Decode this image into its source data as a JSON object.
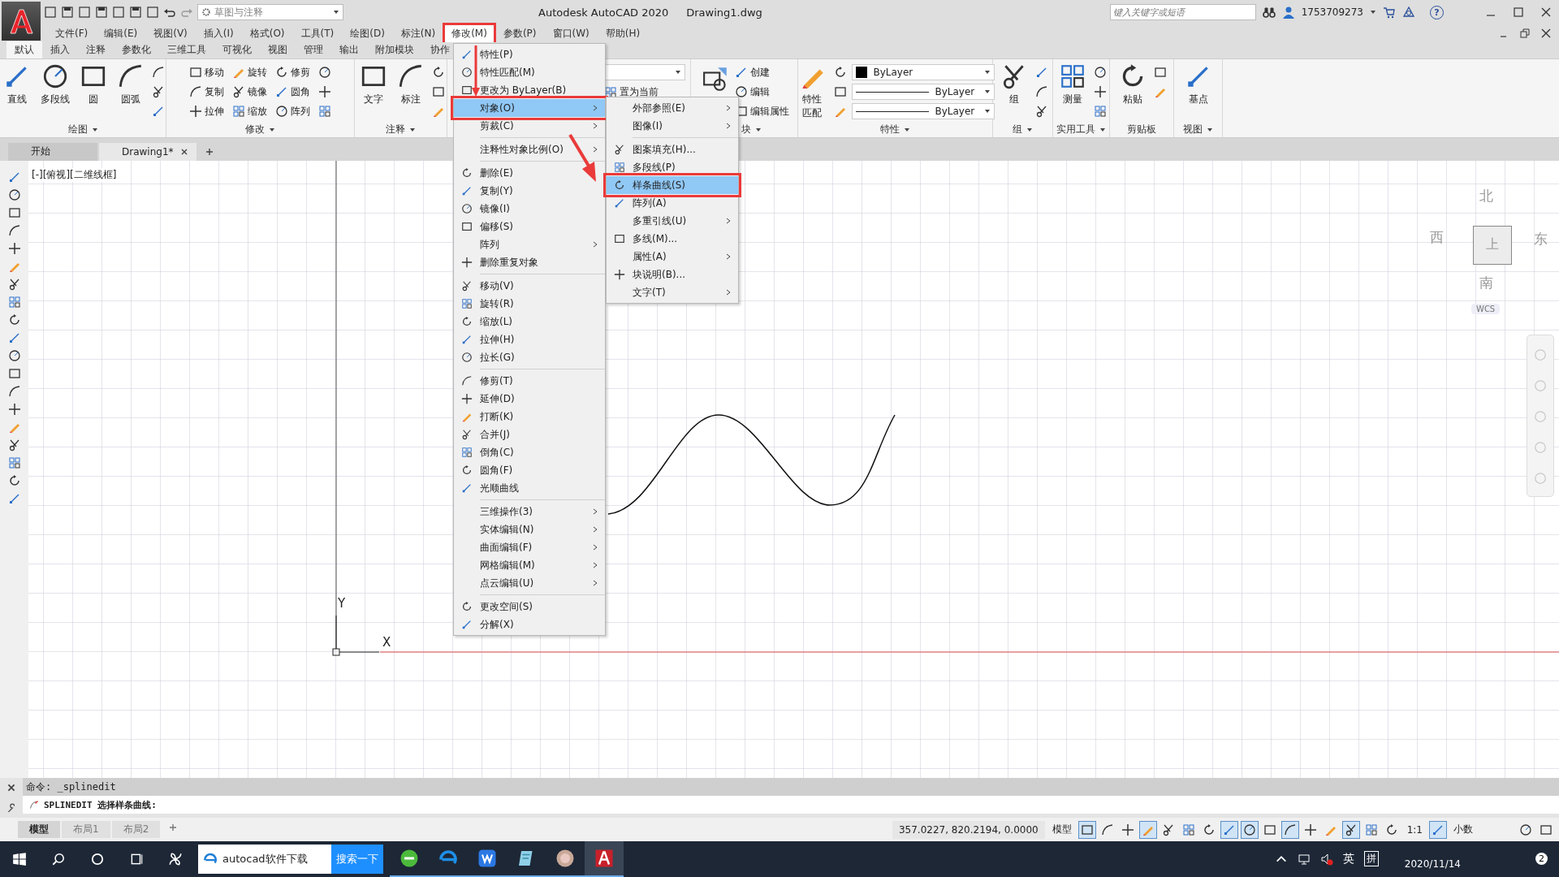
{
  "title_bar": {
    "workspace": "草图与注释",
    "title": "Autodesk AutoCAD 2020",
    "filename": "Drawing1.dwg",
    "search_placeholder": "键入关键字或短语",
    "user": "1753709273",
    "help": "?"
  },
  "menu_bar": [
    {
      "label": "文件(F)",
      "selected": false
    },
    {
      "label": "编辑(E)",
      "selected": false
    },
    {
      "label": "视图(V)",
      "selected": false
    },
    {
      "label": "插入(I)",
      "selected": false
    },
    {
      "label": "格式(O)",
      "selected": false
    },
    {
      "label": "工具(T)",
      "selected": false
    },
    {
      "label": "绘图(D)",
      "selected": false
    },
    {
      "label": "标注(N)",
      "selected": false
    },
    {
      "label": "修改(M)",
      "selected": true
    },
    {
      "label": "参数(P)",
      "selected": false
    },
    {
      "label": "窗口(W)",
      "selected": false
    },
    {
      "label": "帮助(H)",
      "selected": false
    }
  ],
  "ribbon_tabs": [
    {
      "label": "默认",
      "selected": true
    },
    {
      "label": "插入",
      "selected": false
    },
    {
      "label": "注释",
      "selected": false
    },
    {
      "label": "参数化",
      "selected": false
    },
    {
      "label": "三维工具",
      "selected": false
    },
    {
      "label": "可视化",
      "selected": false
    },
    {
      "label": "视图",
      "selected": false
    },
    {
      "label": "管理",
      "selected": false
    },
    {
      "label": "输出",
      "selected": false
    },
    {
      "label": "附加模块",
      "selected": false
    },
    {
      "label": "协作",
      "selected": false
    }
  ],
  "ribbon_panels": [
    {
      "title": "绘图",
      "menu": true,
      "tools": [
        {
          "kind": "large",
          "label": "直线"
        },
        {
          "kind": "large",
          "label": "多段线"
        },
        {
          "kind": "large",
          "label": "圆"
        },
        {
          "kind": "large",
          "label": "圆弧"
        },
        {
          "kind": "icon"
        },
        {
          "kind": "icon"
        },
        {
          "kind": "icon"
        }
      ]
    },
    {
      "title": "修改",
      "menu": true,
      "tools": [
        {
          "kind": "small",
          "label": "移动"
        },
        {
          "kind": "small",
          "label": "复制"
        },
        {
          "kind": "small",
          "label": "拉伸"
        },
        {
          "kind": "small",
          "label": "旋转"
        },
        {
          "kind": "small",
          "label": "镜像"
        },
        {
          "kind": "small",
          "label": "缩放"
        },
        {
          "kind": "small",
          "label": "修剪"
        },
        {
          "kind": "small",
          "label": "圆角"
        },
        {
          "kind": "small",
          "label": "阵列"
        },
        {
          "kind": "icon"
        },
        {
          "kind": "icon"
        },
        {
          "kind": "icon"
        }
      ]
    },
    {
      "title": "注释",
      "menu": true,
      "tools": [
        {
          "kind": "large",
          "label": "文字"
        },
        {
          "kind": "large",
          "label": "标注"
        },
        {
          "kind": "icon"
        },
        {
          "kind": "icon"
        },
        {
          "kind": "icon"
        }
      ]
    },
    {
      "tools": [
        {
          "kind": "dropdown"
        },
        {
          "kind": "small",
          "label": "置为当前"
        }
      ]
    },
    {
      "title": "块",
      "menu": true,
      "tools": [
        {
          "kind": "bigicon"
        },
        {
          "kind": "small",
          "label": "创建"
        },
        {
          "kind": "small",
          "label": "编辑"
        },
        {
          "kind": "small",
          "label": "编辑属性"
        }
      ]
    },
    {
      "title": "特性",
      "menu": true,
      "tools": [
        {
          "kind": "large",
          "label": "特性匹配"
        },
        {
          "kind": "icon"
        },
        {
          "kind": "icon"
        },
        {
          "kind": "icon"
        },
        {
          "kind": "colordropdown",
          "value": "ByLayer"
        },
        {
          "kind": "linedropdown",
          "value": "ByLayer"
        },
        {
          "kind": "linedropdown",
          "value": "ByLayer"
        }
      ]
    },
    {
      "title": "组",
      "menu": true,
      "tools": [
        {
          "kind": "large",
          "label": "组"
        },
        {
          "kind": "icon"
        },
        {
          "kind": "icon"
        },
        {
          "kind": "icon"
        }
      ]
    },
    {
      "title": "实用工具",
      "menu": true,
      "tools": [
        {
          "kind": "large",
          "label": "测量"
        },
        {
          "kind": "icon"
        },
        {
          "kind": "icon"
        },
        {
          "kind": "icon"
        }
      ]
    },
    {
      "title": "剪贴板",
      "menu": false,
      "tools": [
        {
          "kind": "large",
          "label": "粘贴"
        },
        {
          "kind": "icon"
        },
        {
          "kind": "icon"
        }
      ]
    },
    {
      "title": "视图",
      "menu": true,
      "tools": [
        {
          "kind": "large",
          "label": "基点"
        }
      ]
    }
  ],
  "document_tabs": [
    {
      "label": "开始",
      "selected": false
    },
    {
      "label": "Drawing1*",
      "selected": true
    }
  ],
  "viewport_label": "[-][俯视][二维线框]",
  "viewcube": {
    "north": "北",
    "south": "南",
    "east": "东",
    "west": "西",
    "face": "上",
    "ucs": "WCS"
  },
  "axes": {
    "y": "Y",
    "x": "X"
  },
  "modify_menu": [
    {
      "kind": "item",
      "label": "特性(P)",
      "icon": true,
      "submenu": false,
      "selected": false
    },
    {
      "kind": "item",
      "label": "特性匹配(M)",
      "icon": true,
      "submenu": false,
      "selected": false
    },
    {
      "kind": "item",
      "label": "更改为 ByLayer(B)",
      "icon": true,
      "submenu": false,
      "selected": false
    },
    {
      "kind": "item",
      "label": "对象(O)",
      "icon": false,
      "submenu": true,
      "selected": true
    },
    {
      "kind": "item",
      "label": "剪裁(C)",
      "icon": false,
      "submenu": true,
      "selected": false
    },
    {
      "kind": "separator"
    },
    {
      "kind": "item",
      "label": "注释性对象比例(O)",
      "icon": false,
      "submenu": true,
      "selected": false
    },
    {
      "kind": "separator"
    },
    {
      "kind": "item",
      "label": "删除(E)",
      "icon": true,
      "submenu": false,
      "selected": false
    },
    {
      "kind": "item",
      "label": "复制(Y)",
      "icon": true,
      "submenu": false,
      "selected": false
    },
    {
      "kind": "item",
      "label": "镜像(I)",
      "icon": true,
      "submenu": false,
      "selected": false
    },
    {
      "kind": "item",
      "label": "偏移(S)",
      "icon": true,
      "submenu": false,
      "selected": false
    },
    {
      "kind": "item",
      "label": "阵列",
      "icon": false,
      "submenu": true,
      "selected": false
    },
    {
      "kind": "item",
      "label": "删除重复对象",
      "icon": true,
      "submenu": false,
      "selected": false
    },
    {
      "kind": "separator"
    },
    {
      "kind": "item",
      "label": "移动(V)",
      "icon": true,
      "submenu": false,
      "selected": false
    },
    {
      "kind": "item",
      "label": "旋转(R)",
      "icon": true,
      "submenu": false,
      "selected": false
    },
    {
      "kind": "item",
      "label": "缩放(L)",
      "icon": true,
      "submenu": false,
      "selected": false
    },
    {
      "kind": "item",
      "label": "拉伸(H)",
      "icon": true,
      "submenu": false,
      "selected": false
    },
    {
      "kind": "item",
      "label": "拉长(G)",
      "icon": true,
      "submenu": false,
      "selected": false
    },
    {
      "kind": "separator"
    },
    {
      "kind": "item",
      "label": "修剪(T)",
      "icon": true,
      "submenu": false,
      "selected": false
    },
    {
      "kind": "item",
      "label": "延伸(D)",
      "icon": true,
      "submenu": false,
      "selected": false
    },
    {
      "kind": "item",
      "label": "打断(K)",
      "icon": true,
      "submenu": false,
      "selected": false
    },
    {
      "kind": "item",
      "label": "合并(J)",
      "icon": true,
      "submenu": false,
      "selected": false
    },
    {
      "kind": "item",
      "label": "倒角(C)",
      "icon": true,
      "submenu": false,
      "selected": false
    },
    {
      "kind": "item",
      "label": "圆角(F)",
      "icon": true,
      "submenu": false,
      "selected": false
    },
    {
      "kind": "item",
      "label": "光顺曲线",
      "icon": true,
      "submenu": false,
      "selected": false
    },
    {
      "kind": "separator"
    },
    {
      "kind": "item",
      "label": "三维操作(3)",
      "icon": false,
      "submenu": true,
      "selected": false
    },
    {
      "kind": "item",
      "label": "实体编辑(N)",
      "icon": false,
      "submenu": true,
      "selected": false
    },
    {
      "kind": "item",
      "label": "曲面编辑(F)",
      "icon": false,
      "submenu": true,
      "selected": false
    },
    {
      "kind": "item",
      "label": "网格编辑(M)",
      "icon": false,
      "submenu": true,
      "selected": false
    },
    {
      "kind": "item",
      "label": "点云编辑(U)",
      "icon": false,
      "submenu": true,
      "selected": false
    },
    {
      "kind": "separator"
    },
    {
      "kind": "item",
      "label": "更改空间(S)",
      "icon": true,
      "submenu": false,
      "selected": false
    },
    {
      "kind": "item",
      "label": "分解(X)",
      "icon": true,
      "submenu": false,
      "selected": false
    }
  ],
  "object_submenu": [
    {
      "kind": "item",
      "label": "外部参照(E)",
      "icon": false,
      "submenu": true,
      "selected": false
    },
    {
      "kind": "item",
      "label": "图像(I)",
      "icon": false,
      "submenu": true,
      "selected": false
    },
    {
      "kind": "separator"
    },
    {
      "kind": "item",
      "label": "图案填充(H)...",
      "icon": true,
      "submenu": false,
      "selected": false
    },
    {
      "kind": "item",
      "label": "多段线(P)",
      "icon": true,
      "submenu": false,
      "selected": false
    },
    {
      "kind": "item",
      "label": "样条曲线(S)",
      "icon": true,
      "submenu": false,
      "selected": true
    },
    {
      "kind": "item",
      "label": "阵列(A)",
      "icon": true,
      "submenu": false,
      "selected": false
    },
    {
      "kind": "item",
      "label": "多重引线(U)",
      "icon": false,
      "submenu": true,
      "selected": false
    },
    {
      "kind": "item",
      "label": "多线(M)...",
      "icon": true,
      "submenu": false,
      "selected": false
    },
    {
      "kind": "item",
      "label": "属性(A)",
      "icon": false,
      "submenu": true,
      "selected": false
    },
    {
      "kind": "item",
      "label": "块说明(B)...",
      "icon": true,
      "submenu": false,
      "selected": false
    },
    {
      "kind": "item",
      "label": "文字(T)",
      "icon": false,
      "submenu": true,
      "selected": false
    }
  ],
  "command_line": {
    "history": "命令: _splinedit",
    "prompt": "SPLINEDIT 选择样条曲线:"
  },
  "layout_tabs": [
    {
      "label": "模型",
      "selected": true
    },
    {
      "label": "布局1",
      "selected": false
    },
    {
      "label": "布局2",
      "selected": false
    }
  ],
  "status_bar": {
    "coordinates": "357.0227, 820.2194, 0.0000",
    "space": "模型",
    "scale": "1:1",
    "units": "小数",
    "toggles": [
      {
        "on": true
      },
      {
        "on": false
      },
      {
        "on": false
      },
      {
        "on": true
      },
      {
        "on": false
      },
      {
        "on": false
      },
      {
        "on": false
      },
      {
        "on": true
      },
      {
        "on": true
      },
      {
        "on": false
      },
      {
        "on": true
      },
      {
        "on": false
      },
      {
        "on": false
      },
      {
        "on": true
      },
      {
        "on": false
      },
      {
        "on": false
      },
      {
        "on": true
      },
      {
        "on": false
      },
      {
        "on": false
      }
    ]
  },
  "taskbar": {
    "search_value": "autocad软件下载",
    "search_button": "搜索一下",
    "apps": [
      {
        "selected": false
      },
      {
        "selected": false
      },
      {
        "selected": false
      },
      {
        "selected": false
      },
      {
        "selected": false
      },
      {
        "selected": true
      }
    ],
    "ime_language": "英",
    "ime_mode": "拼",
    "date": "2020/11/14",
    "notifications": "2"
  }
}
